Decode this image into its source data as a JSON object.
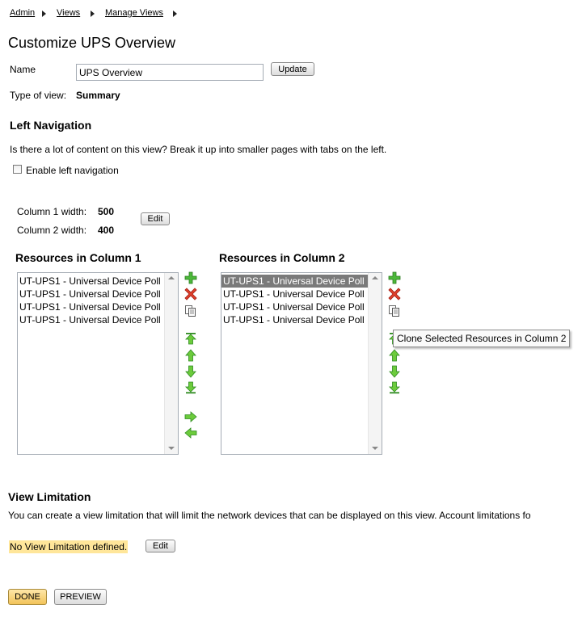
{
  "breadcrumb": {
    "items": [
      "Admin",
      "Views",
      "Manage Views"
    ]
  },
  "page": {
    "title": "Customize UPS Overview"
  },
  "name_field": {
    "label": "Name",
    "value": "UPS Overview",
    "update_label": "Update"
  },
  "view_type": {
    "label": "Type of view:",
    "value": "Summary"
  },
  "left_nav": {
    "title": "Left Navigation",
    "description": "Is there a lot of content on this view? Break it up into smaller pages with tabs on the left.",
    "checkbox_label": "Enable left navigation"
  },
  "columns": {
    "col1_label": "Column 1 width:",
    "col1_value": "500",
    "col2_label": "Column 2 width:",
    "col2_value": "400",
    "edit_label": "Edit"
  },
  "resources": {
    "col1": {
      "title": "Resources in Column 1",
      "items": [
        "UT-UPS1 - Universal Device Poll",
        "UT-UPS1 - Universal Device Poll",
        "UT-UPS1 - Universal Device Poll",
        "UT-UPS1 - Universal Device Poll"
      ]
    },
    "col2": {
      "title": "Resources in Column 2",
      "items": [
        "UT-UPS1 - Universal Device Poll",
        "UT-UPS1 - Universal Device Poll",
        "UT-UPS1 - Universal Device Poll",
        "UT-UPS1 - Universal Device Poll"
      ],
      "selected_index": 0
    },
    "tooltip": "Clone Selected Resources in Column 2"
  },
  "view_limitation": {
    "title": "View Limitation",
    "description": "You can create a view limitation that will limit the network devices that can be displayed on this view. Account limitations fo",
    "status": "No View Limitation defined.",
    "edit_label": "Edit"
  },
  "actions": {
    "done_label": "DONE",
    "preview_label": "PREVIEW"
  },
  "colors": {
    "add": "#3a9a2a",
    "remove": "#d02a1c",
    "arrow": "#5fbf2f",
    "highlight": "#ffe69a",
    "selected": "#7a7a7a"
  },
  "icons": [
    "plus-icon",
    "delete-icon",
    "clone-icon",
    "move-top-icon",
    "move-up-icon",
    "move-down-icon",
    "move-bottom-icon",
    "move-right-icon",
    "move-left-icon"
  ]
}
